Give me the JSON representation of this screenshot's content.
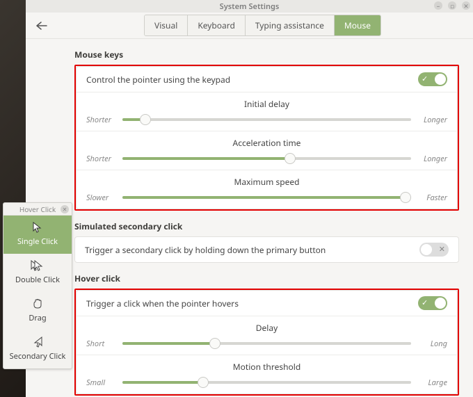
{
  "window": {
    "title": "System Settings"
  },
  "tabs": {
    "visual": "Visual",
    "keyboard": "Keyboard",
    "typing": "Typing assistance",
    "mouse": "Mouse"
  },
  "sections": {
    "mouseKeys": {
      "title": "Mouse keys",
      "control": {
        "label": "Control the pointer using the keypad",
        "on": true
      },
      "initialDelay": {
        "title": "Initial delay",
        "left": "Shorter",
        "right": "Longer",
        "value": 8
      },
      "accelTime": {
        "title": "Acceleration time",
        "left": "Shorter",
        "right": "Longer",
        "value": 58
      },
      "maxSpeed": {
        "title": "Maximum speed",
        "left": "Slower",
        "right": "Faster",
        "value": 98
      }
    },
    "simSecondary": {
      "title": "Simulated secondary click",
      "trigger": {
        "label": "Trigger a secondary click by holding down the primary button",
        "on": false
      }
    },
    "hoverClick": {
      "title": "Hover click",
      "trigger": {
        "label": "Trigger a click when the pointer hovers",
        "on": true
      },
      "delay": {
        "title": "Delay",
        "left": "Short",
        "right": "Long",
        "value": 32
      },
      "thresh": {
        "title": "Motion threshold",
        "left": "Small",
        "right": "Large",
        "value": 28
      }
    }
  },
  "hoverPanel": {
    "title": "Hover Click",
    "items": {
      "single": "Single Click",
      "double": "Double Click",
      "drag": "Drag",
      "secondary": "Secondary Click"
    }
  }
}
